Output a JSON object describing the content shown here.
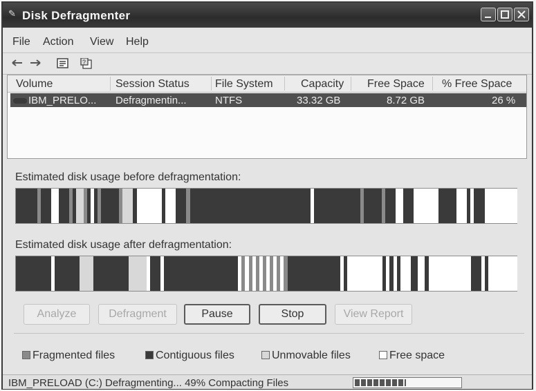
{
  "window": {
    "title": "Disk Defragmenter"
  },
  "menu": {
    "items": [
      "File",
      "Action",
      "View",
      "Help"
    ]
  },
  "toolbar": {
    "icons": [
      "back-arrow-icon",
      "forward-arrow-icon",
      "properties-icon",
      "help-icon"
    ]
  },
  "volumes": {
    "columns": [
      "Volume",
      "Session Status",
      "File System",
      "Capacity",
      "Free Space",
      "% Free Space"
    ],
    "rows": [
      {
        "volume": "IBM_PRELO...",
        "status": "Defragmentin...",
        "file_system": "NTFS",
        "capacity": "33.32 GB",
        "free_space": "8.72 GB",
        "pct_free": "26 %"
      }
    ]
  },
  "analysis": {
    "before_label": "Estimated disk usage before defragmentation:",
    "after_label": "Estimated disk usage after defragmentation:"
  },
  "buttons": {
    "analyze": "Analyze",
    "defragment": "Defragment",
    "pause": "Pause",
    "stop": "Stop",
    "view_report": "View Report"
  },
  "legend": {
    "fragmented": "Fragmented files",
    "contiguous": "Contiguous files",
    "unmovable": "Unmovable files",
    "free": "Free space"
  },
  "status": {
    "text": "IBM_PRELOAD (C:) Defragmenting... 49%  Compacting Files",
    "progress": 0.49
  },
  "colors": {
    "fragmented": "#8a8a8a",
    "contiguous": "#3a3a3a",
    "unmovable": "#d8d8d8",
    "free": "#ffffff",
    "selection": "#4f4f4f"
  }
}
